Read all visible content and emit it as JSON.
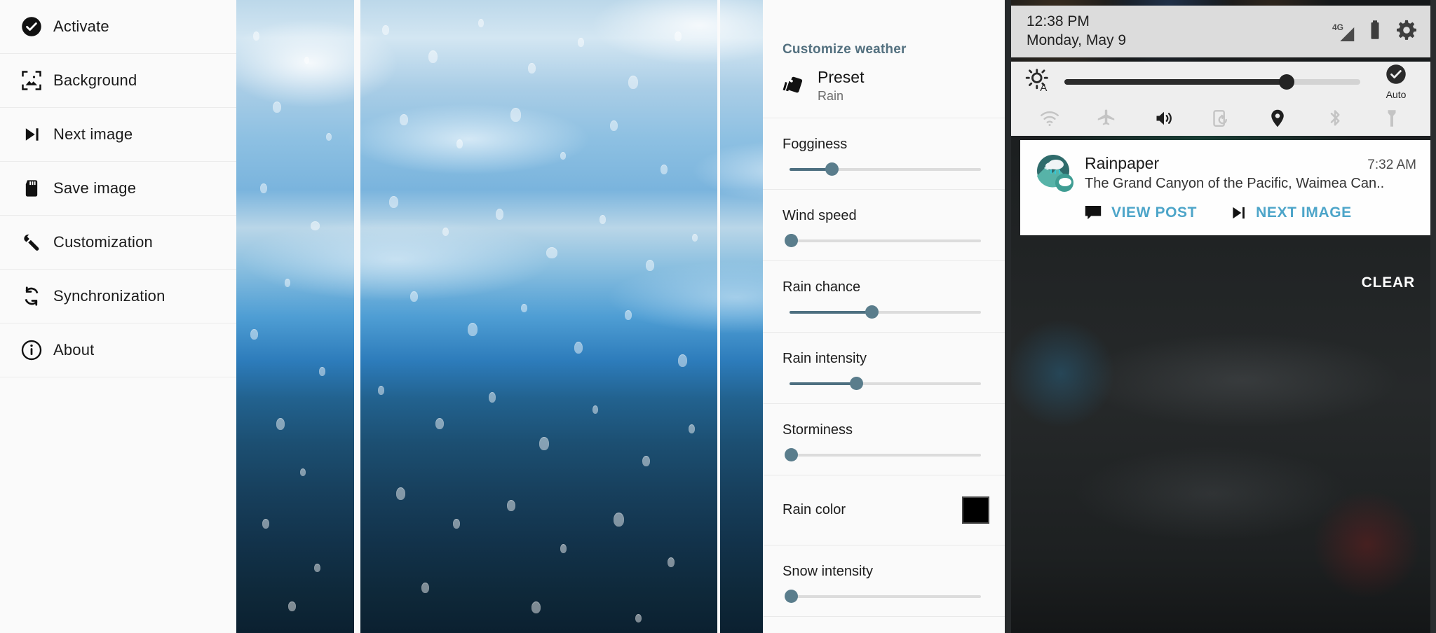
{
  "drawer": {
    "items": [
      {
        "label": "Activate",
        "icon": "check-circle-icon"
      },
      {
        "label": "Background",
        "icon": "image-frame-icon"
      },
      {
        "label": "Next image",
        "icon": "skip-next-icon"
      },
      {
        "label": "Save image",
        "icon": "sd-card-icon"
      },
      {
        "label": "Customization",
        "icon": "wrench-icon"
      },
      {
        "label": "Synchronization",
        "icon": "sync-icon"
      },
      {
        "label": "About",
        "icon": "info-circle-icon"
      }
    ]
  },
  "settings": {
    "section_title": "Customize weather",
    "accent_color": "#53707f",
    "slider_color": "#5a7d8c",
    "preset": {
      "label": "Preset",
      "value": "Rain",
      "icon": "palette-swatch-icon"
    },
    "sliders": [
      {
        "label": "Fogginess",
        "value": 22
      },
      {
        "label": "Wind speed",
        "value": 1
      },
      {
        "label": "Rain chance",
        "value": 43
      },
      {
        "label": "Rain intensity",
        "value": 35
      },
      {
        "label": "Storminess",
        "value": 1
      },
      {
        "label": "Snow intensity",
        "value": 1
      }
    ],
    "color_row": {
      "label": "Rain color",
      "value": "#000000"
    }
  },
  "phone": {
    "statusbar": {
      "time": "12:38 PM",
      "date": "Monday, May 9",
      "network_label": "4G",
      "icons": [
        "signal-icon",
        "battery-icon",
        "gear-icon"
      ]
    },
    "quick_settings": {
      "brightness": 75,
      "brightness_icon": "brightness-auto-icon",
      "auto_label": "Auto",
      "auto_icon": "check-circle-icon",
      "toggles": [
        {
          "name": "wifi-icon",
          "active": false
        },
        {
          "name": "airplane-icon",
          "active": false
        },
        {
          "name": "volume-icon",
          "active": true
        },
        {
          "name": "rotation-lock-icon",
          "active": false
        },
        {
          "name": "location-icon",
          "active": true
        },
        {
          "name": "bluetooth-icon",
          "active": false
        },
        {
          "name": "flashlight-icon",
          "active": false
        }
      ]
    },
    "notification": {
      "app": "Rainpaper",
      "time": "7:32 AM",
      "text": "The Grand Canyon of the Pacific, Waimea Can..",
      "actions": [
        {
          "label": "VIEW POST",
          "icon": "comment-icon"
        },
        {
          "label": "NEXT IMAGE",
          "icon": "skip-next-icon"
        }
      ],
      "action_color": "#4da5c9"
    },
    "clear_label": "CLEAR"
  }
}
